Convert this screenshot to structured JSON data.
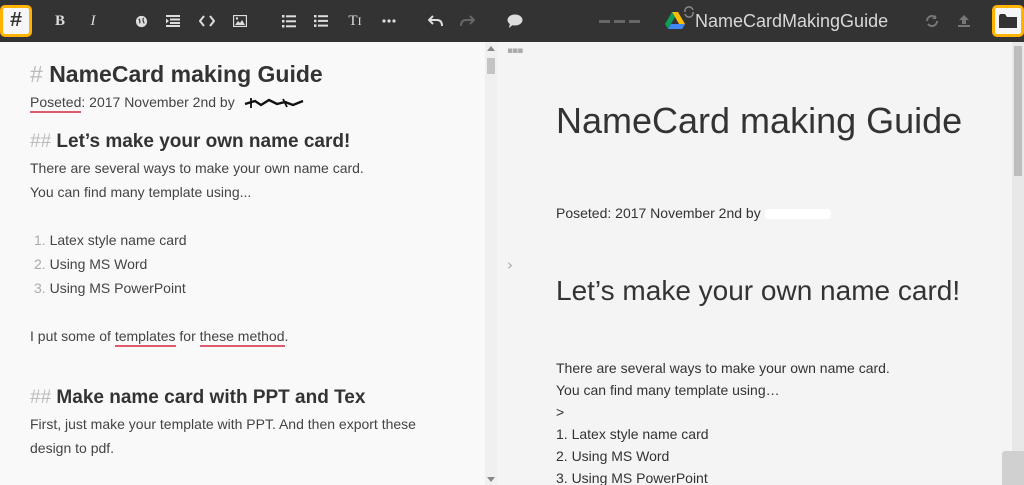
{
  "app": {
    "doc_title": "NameCardMakingGuide",
    "accent_color": "#ffb300",
    "toolbar_bg": "#333333"
  },
  "toolbar": {
    "left_menu_icon": "hash-icon",
    "heading_label": "T",
    "heading_sub": "I",
    "buttons": [
      "bold-icon",
      "italic-icon",
      "link-icon",
      "quote-icon",
      "code-icon",
      "image-icon",
      "ordered-list-icon",
      "bullet-list-icon",
      "heading-icon",
      "hr-icon",
      "undo-icon",
      "redo-icon",
      "comment-icon"
    ],
    "right_buttons": [
      "sync-icon",
      "publish-icon",
      "folder-icon"
    ]
  },
  "editor": {
    "h1_mark": "#",
    "h1": "NameCard making Guide",
    "posted_label": "Poseted",
    "posted_text": ": 2017 November 2nd by",
    "h2_mark": "##",
    "h2a": "Let’s make your own name card!",
    "p1": "There are several ways to make your own name card.",
    "p2": "You can find many template using...",
    "list": [
      {
        "n": "1.",
        "t": "Latex style name card"
      },
      {
        "n": "2.",
        "t": "Using MS Word"
      },
      {
        "n": "3.",
        "t": "Using MS PowerPoint"
      }
    ],
    "p3_pre": "I put some of ",
    "p3_link1": "templates",
    "p3_mid": " for ",
    "p3_link2": "these method",
    "p3_post": ".",
    "h2b": "Make name card with PPT and Tex",
    "p4": "First, just make your template with PPT. And then export these",
    "p5": "design to pdf."
  },
  "preview": {
    "h1": "NameCard making Guide",
    "posted": "Poseted: 2017 November 2nd by",
    "h2": "Let’s make your own name card!",
    "p1": "There are several ways to make your own name card.",
    "p2": "You can find many template using…",
    "gt": ">",
    "list": [
      "1. Latex style name card",
      "2. Using MS Word",
      "3. Using MS PowerPoint"
    ]
  }
}
